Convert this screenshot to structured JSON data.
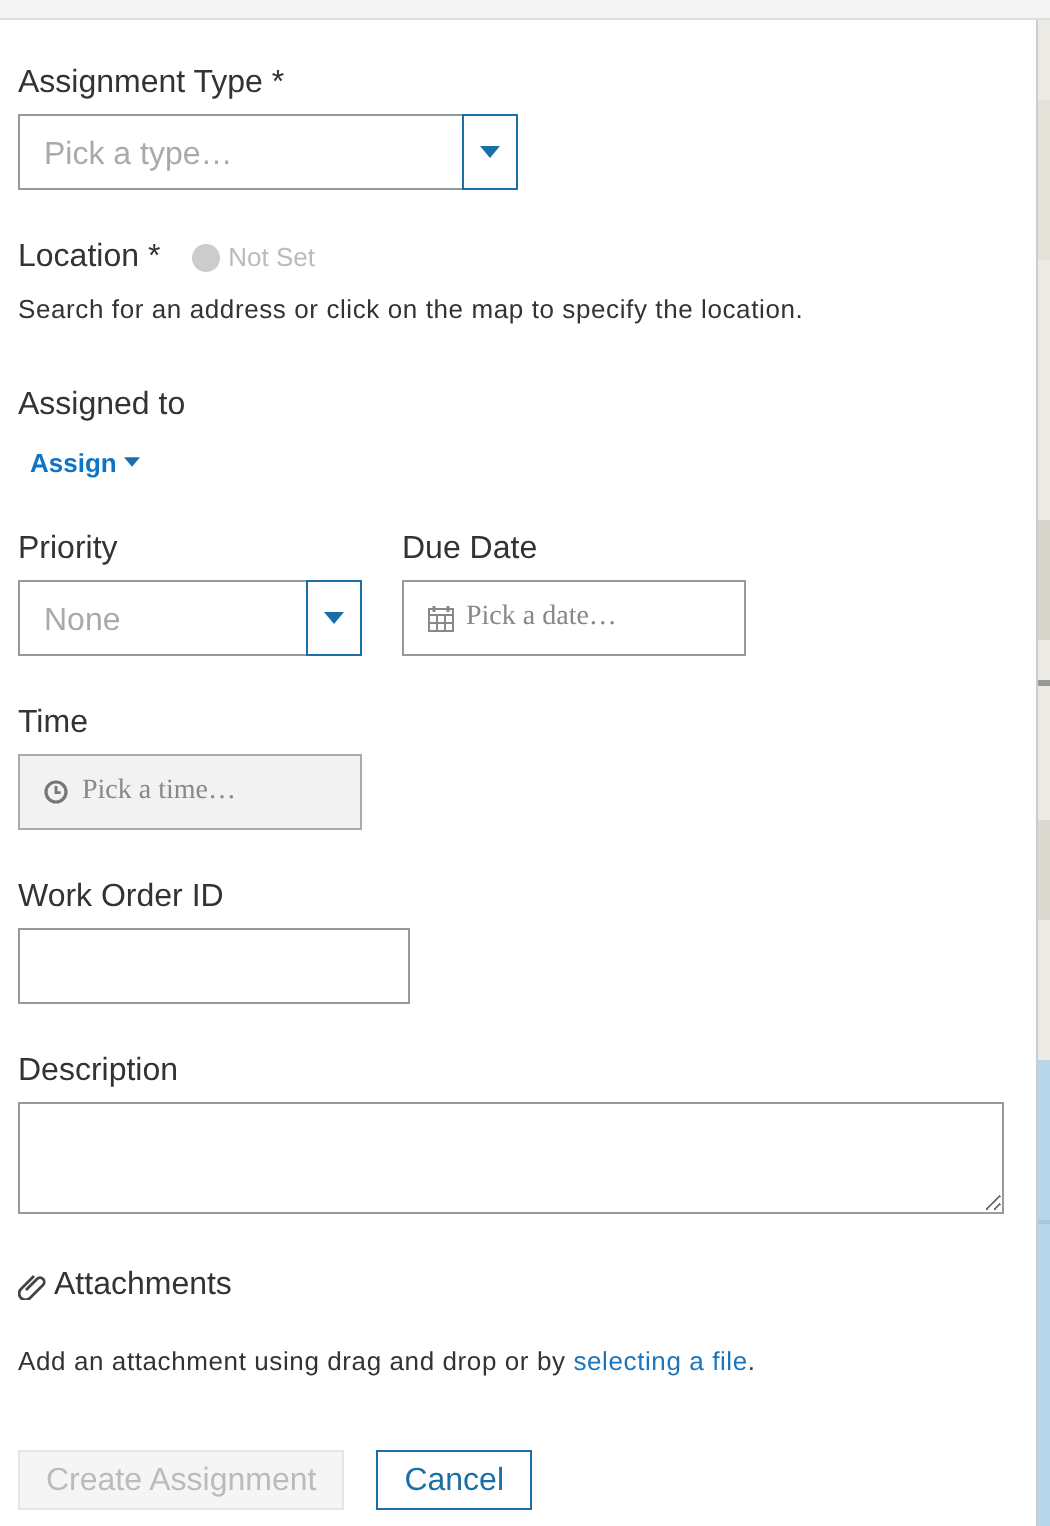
{
  "assignment_type": {
    "label": "Assignment Type *",
    "placeholder": "Pick a type…"
  },
  "location": {
    "label": "Location *",
    "status": "Not Set",
    "set": false,
    "help": "Search for an address or click on the map to specify the location."
  },
  "assigned_to": {
    "label": "Assigned to",
    "button": "Assign"
  },
  "priority": {
    "label": "Priority",
    "value": "None"
  },
  "due_date": {
    "label": "Due Date",
    "placeholder": "Pick a date…"
  },
  "time": {
    "label": "Time",
    "placeholder": "Pick a time…",
    "disabled": true
  },
  "work_order_id": {
    "label": "Work Order ID"
  },
  "description": {
    "label": "Description"
  },
  "attachments": {
    "label": "Attachments",
    "text": "Add an attachment using drag and drop or by ",
    "link": "selecting a file",
    "after": "."
  },
  "buttons": [
    {
      "label": "Create Assignment",
      "kind": "primary",
      "disabled": true
    },
    {
      "label": "Cancel",
      "kind": "secondary",
      "disabled": false
    }
  ]
}
